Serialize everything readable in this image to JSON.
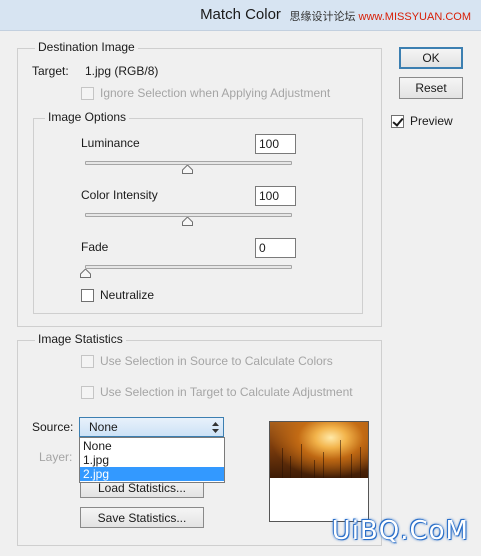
{
  "window": {
    "title": "Match Color",
    "watermark_site": "思缘设计论坛",
    "watermark_url": "www.MISSYUAN.COM"
  },
  "buttons": {
    "ok": "OK",
    "reset": "Reset",
    "preview": "Preview",
    "preview_checked": true
  },
  "destination": {
    "legend": "Destination Image",
    "target_label": "Target:",
    "target_value": "1.jpg (RGB/8)",
    "ignore_selection": "Ignore Selection when Applying Adjustment"
  },
  "image_options": {
    "legend": "Image Options",
    "luminance_label": "Luminance",
    "luminance_value": "100",
    "color_intensity_label": "Color Intensity",
    "color_intensity_value": "100",
    "fade_label": "Fade",
    "fade_value": "0",
    "neutralize": "Neutralize",
    "neutralize_checked": false
  },
  "image_statistics": {
    "legend": "Image Statistics",
    "use_selection_source": "Use Selection in Source to Calculate Colors",
    "use_selection_target": "Use Selection in Target to Calculate Adjustment",
    "source_label": "Source:",
    "source_value": "None",
    "layer_label": "Layer:",
    "source_options": [
      "None",
      "1.jpg",
      "2.jpg"
    ],
    "highlighted_option": "2.jpg",
    "load_statistics": "Load Statistics...",
    "save_statistics": "Save Statistics..."
  },
  "footer_watermark": "UiBQ.CoM",
  "colors": {
    "accent": "#3c7fb1",
    "highlight": "#3399ff",
    "disabled_text": "#a5a5a5"
  }
}
